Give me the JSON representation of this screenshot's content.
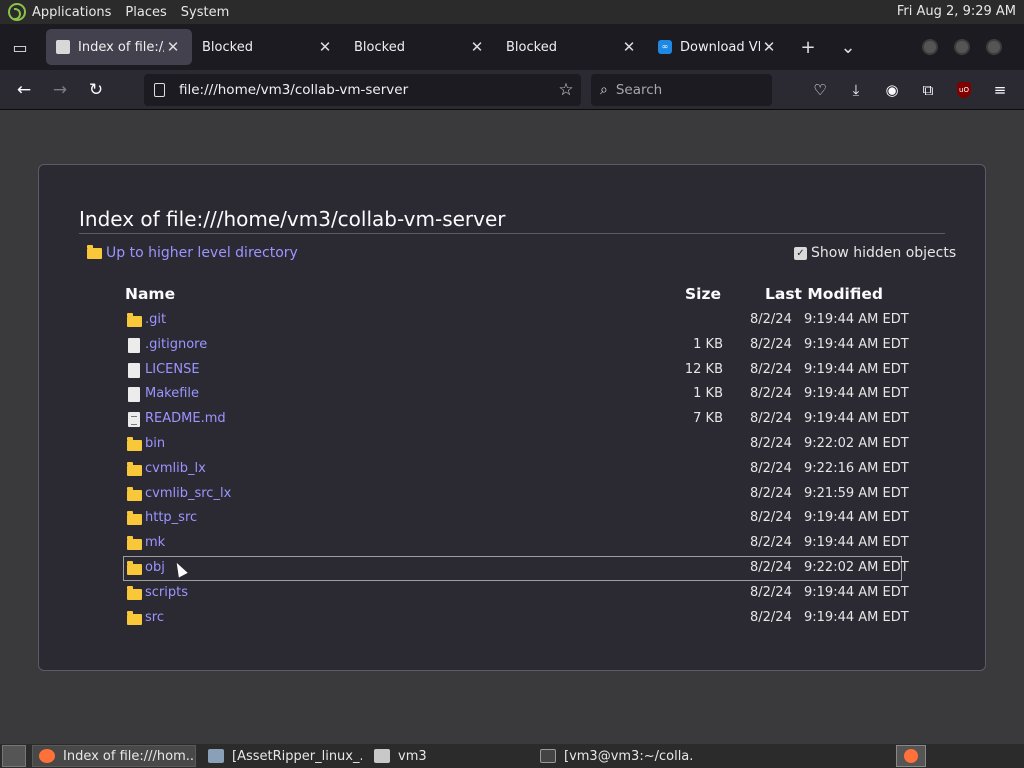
{
  "top_panel": {
    "menus": [
      "Applications",
      "Places",
      "System"
    ],
    "clock": "Fri Aug  2,  9:29 AM"
  },
  "tabs": [
    {
      "title": "Index of file:///h",
      "favicon": "file-icon",
      "active": true
    },
    {
      "title": "Blocked",
      "favicon": "",
      "active": false
    },
    {
      "title": "Blocked",
      "favicon": "",
      "active": false
    },
    {
      "title": "Blocked",
      "favicon": "",
      "active": false
    },
    {
      "title": "Download VPN",
      "favicon": "vpn-icon",
      "active": false
    }
  ],
  "nav": {
    "url": "file:///home/vm3/collab-vm-server",
    "search_placeholder": "Search"
  },
  "page": {
    "title": "Index of file:///home/vm3/collab-vm-server",
    "up_link": "Up to higher level directory",
    "show_hidden": "Show hidden objects",
    "show_hidden_checked": true,
    "headers": {
      "name": "Name",
      "size": "Size",
      "modified": "Last Modified"
    },
    "entries": [
      {
        "name": ".git",
        "type": "folder",
        "size": "",
        "date": "8/2/24",
        "time": "9:19:44 AM EDT"
      },
      {
        "name": ".gitignore",
        "type": "file",
        "size": "1 KB",
        "date": "8/2/24",
        "time": "9:19:44 AM EDT"
      },
      {
        "name": "LICENSE",
        "type": "file",
        "size": "12 KB",
        "date": "8/2/24",
        "time": "9:19:44 AM EDT"
      },
      {
        "name": "Makefile",
        "type": "file",
        "size": "1 KB",
        "date": "8/2/24",
        "time": "9:19:44 AM EDT"
      },
      {
        "name": "README.md",
        "type": "text",
        "size": "7 KB",
        "date": "8/2/24",
        "time": "9:19:44 AM EDT"
      },
      {
        "name": "bin",
        "type": "folder",
        "size": "",
        "date": "8/2/24",
        "time": "9:22:02 AM EDT"
      },
      {
        "name": "cvmlib_lx",
        "type": "folder",
        "size": "",
        "date": "8/2/24",
        "time": "9:22:16 AM EDT"
      },
      {
        "name": "cvmlib_src_lx",
        "type": "folder",
        "size": "",
        "date": "8/2/24",
        "time": "9:21:59 AM EDT"
      },
      {
        "name": "http_src",
        "type": "folder",
        "size": "",
        "date": "8/2/24",
        "time": "9:19:44 AM EDT"
      },
      {
        "name": "mk",
        "type": "folder",
        "size": "",
        "date": "8/2/24",
        "time": "9:19:44 AM EDT"
      },
      {
        "name": "obj",
        "type": "folder",
        "size": "",
        "date": "8/2/24",
        "time": "9:22:02 AM EDT",
        "selected": true
      },
      {
        "name": "scripts",
        "type": "folder",
        "size": "",
        "date": "8/2/24",
        "time": "9:19:44 AM EDT"
      },
      {
        "name": "src",
        "type": "folder",
        "size": "",
        "date": "8/2/24",
        "time": "9:19:44 AM EDT"
      }
    ]
  },
  "taskbar": [
    {
      "label": "Index of file:///hom...",
      "icon": "firefox-icon",
      "active": true
    },
    {
      "label": "[AssetRipper_linux_...",
      "icon": "image-icon",
      "active": false
    },
    {
      "label": "vm3",
      "icon": "folder-icon",
      "active": false
    },
    {
      "label": "[vm3@vm3:~/colla...",
      "icon": "terminal-icon",
      "active": false
    }
  ]
}
